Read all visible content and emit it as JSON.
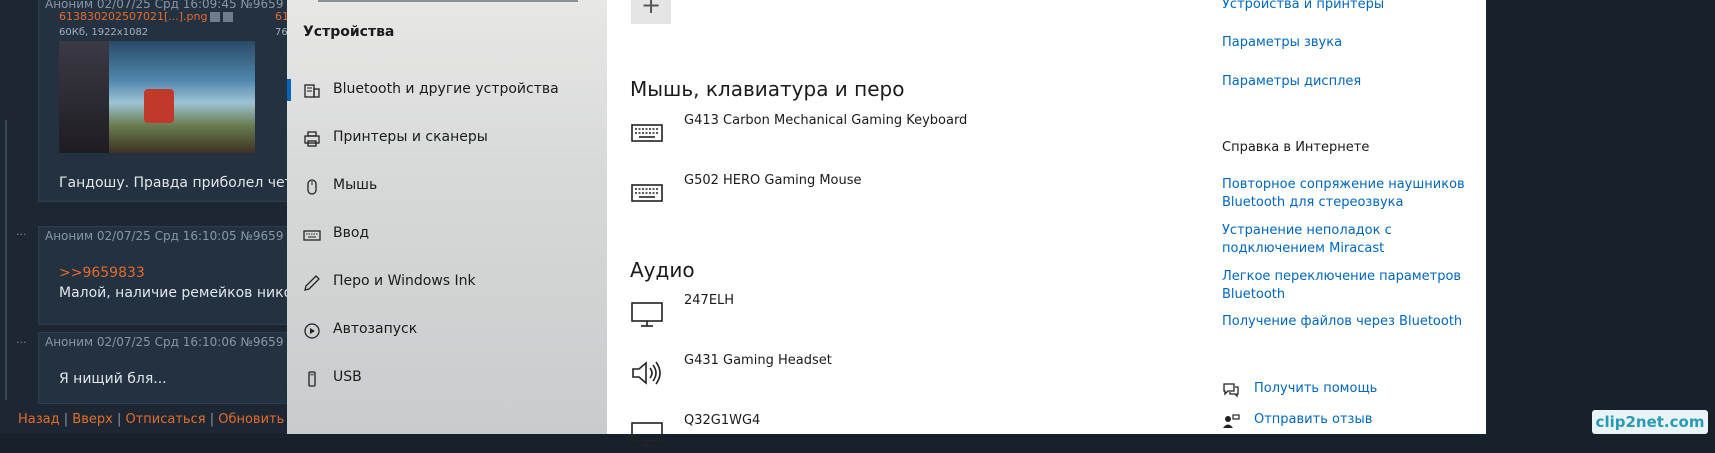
{
  "forum": {
    "posts": [
      {
        "header": "Аноним  02/07/25 Срд 16:09:45 №9659",
        "file_name": "613830202507021[...].png",
        "file_meta": "60Кб, 1922x1082",
        "file_name2": "61",
        "file_meta2": "76",
        "text": "Гандошу. Правда приболел чето"
      },
      {
        "header": "Аноним  02/07/25 Срд 16:10:05 №9659",
        "reply": ">>9659833",
        "text": "Малой, наличие ремейков нико"
      },
      {
        "header": "Аноним  02/07/25 Срд 16:10:06 №9659",
        "text": "Я нищий бля..."
      }
    ],
    "dots": "···",
    "nav": [
      "Назад",
      "Вверх",
      "Отписаться",
      "Обновить"
    ],
    "separator": "|"
  },
  "settings_sidebar": {
    "section_title": "Устройства",
    "items": [
      {
        "label": "Bluetooth и другие устройства",
        "icon": "bluetooth-devices-icon",
        "active": true
      },
      {
        "label": "Принтеры и сканеры",
        "icon": "printer-icon",
        "active": false
      },
      {
        "label": "Мышь",
        "icon": "mouse-icon",
        "active": false
      },
      {
        "label": "Ввод",
        "icon": "keyboard-icon",
        "active": false
      },
      {
        "label": "Перо и Windows Ink",
        "icon": "pen-icon",
        "active": false
      },
      {
        "label": "Автозапуск",
        "icon": "autoplay-icon",
        "active": false
      },
      {
        "label": "USB",
        "icon": "usb-icon",
        "active": false
      }
    ]
  },
  "main": {
    "add_symbol": "+",
    "sections": [
      {
        "title": "Мышь, клавиатура и перо",
        "devices": [
          {
            "name": "G413 Carbon Mechanical Gaming Keyboard",
            "icon": "keyboard-icon"
          },
          {
            "name": "G502 HERO Gaming Mouse",
            "icon": "keyboard-icon"
          }
        ]
      },
      {
        "title": "Аудио",
        "devices": [
          {
            "name": "247ELH",
            "icon": "monitor-icon"
          },
          {
            "name": "G431 Gaming Headset",
            "icon": "speaker-icon"
          },
          {
            "name": "Q32G1WG4",
            "icon": "monitor-icon"
          }
        ]
      }
    ]
  },
  "related": {
    "links": [
      "Устройства и принтеры",
      "Параметры звука",
      "Параметры дисплея"
    ],
    "web_help_title": "Справка в Интернете",
    "web_help_links": [
      "Повторное сопряжение наушников Bluetooth для стереозвука",
      "Устранение неполадок с подключением Miracast",
      "Легкое переключение параметров Bluetooth",
      "Получение файлов через Bluetooth"
    ],
    "get_help": "Получить помощь",
    "feedback": "Отправить отзыв"
  },
  "watermark": "clip2net.com",
  "colors": {
    "accent": "#0067c0",
    "forum_link": "#e36c2b",
    "forum_bg": "#1d2733"
  }
}
